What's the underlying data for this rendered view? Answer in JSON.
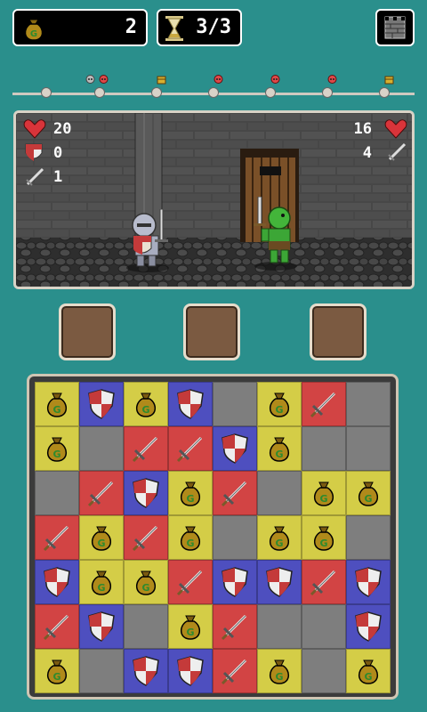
{
  "hud": {
    "gold_count": "2",
    "turns": "3/3",
    "gold_icon": "gold-bag-icon",
    "hourglass_icon": "hourglass-icon",
    "tower_icon": "tower-icon"
  },
  "progress_track": {
    "markers": [
      {
        "type": "skull-enemy"
      },
      {
        "type": "treasure"
      },
      {
        "type": "enemy"
      },
      {
        "type": "enemy"
      },
      {
        "type": "enemy"
      },
      {
        "type": "treasure"
      }
    ]
  },
  "battle": {
    "player": {
      "health": "20",
      "armor": "0",
      "attack": "1"
    },
    "enemy": {
      "health": "16",
      "attack": "4"
    }
  },
  "item_slots": [
    "",
    "",
    ""
  ],
  "colors": {
    "gold": "#d4cd47",
    "shield": "#4e4fbf",
    "sword": "#d24444",
    "empty": "#7e7e7e",
    "background": "#2a8f8c"
  },
  "board": [
    [
      "gold",
      "shield",
      "gold",
      "shield",
      "empty",
      "gold",
      "sword",
      "empty"
    ],
    [
      "gold",
      "empty",
      "sword",
      "sword",
      "shield",
      "gold",
      "empty",
      "empty"
    ],
    [
      "empty",
      "sword",
      "shield",
      "gold",
      "sword",
      "empty",
      "gold",
      "gold"
    ],
    [
      "sword",
      "gold",
      "sword",
      "gold",
      "empty",
      "gold",
      "gold",
      "empty"
    ],
    [
      "shield",
      "gold",
      "gold",
      "sword",
      "shield",
      "shield",
      "sword",
      "shield"
    ],
    [
      "sword",
      "shield",
      "empty",
      "gold",
      "sword",
      "empty",
      "empty",
      "shield"
    ],
    [
      "gold",
      "empty",
      "shield",
      "shield",
      "sword",
      "gold",
      "empty",
      "gold"
    ]
  ]
}
